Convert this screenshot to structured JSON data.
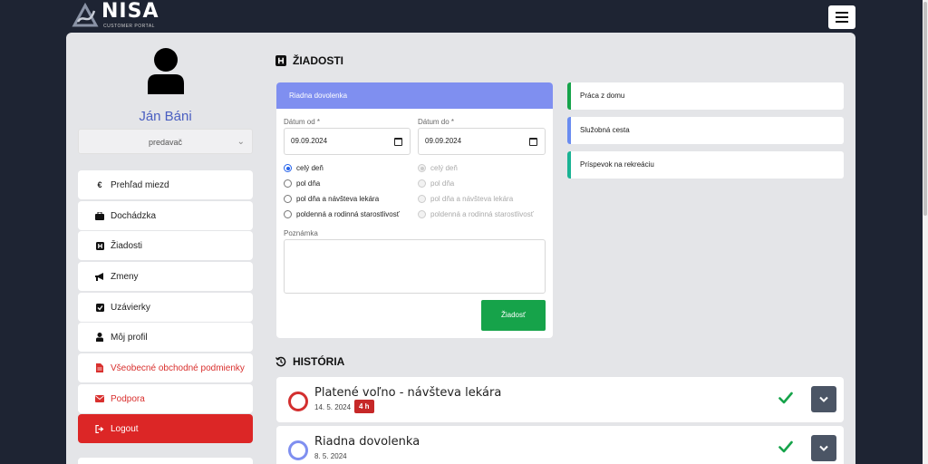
{
  "app": {
    "logo_text": "NISA",
    "logo_sub": "CUSTOMER PORTAL"
  },
  "user": {
    "name": "Ján Báni",
    "role": "predavač"
  },
  "nav": [
    {
      "label": "Prehľad miezd",
      "icon": "euro-icon"
    },
    {
      "label": "Dochádzka",
      "icon": "briefcase-icon"
    },
    {
      "label": "Žiadosti",
      "icon": "h-square-icon"
    },
    {
      "label": "Zmeny",
      "icon": "megaphone-icon"
    },
    {
      "label": "Uzávierky",
      "icon": "check-square-icon"
    },
    {
      "label": "Môj profil",
      "icon": "user-icon"
    },
    {
      "label": "Všeobecné obchodné podmienky",
      "icon": "document-icon"
    },
    {
      "label": "Podpora",
      "icon": "envelope-icon"
    },
    {
      "label": "Logout",
      "icon": "sign-out-icon"
    }
  ],
  "requests": {
    "title": "ŽIADOSTI",
    "form": {
      "header": "Riadna dovolenka",
      "date_from_label": "Dátum od *",
      "date_from_value": "09.09.2024",
      "date_to_label": "Dátum do *",
      "date_to_value": "09.09.2024",
      "options_from": [
        "celý deň",
        "pol dňa",
        "pol dňa a návšteva lekára",
        "poldenná a rodinná starostlivosť"
      ],
      "options_to": [
        "celý deň",
        "pol dňa",
        "pol dňa a návšteva lekára",
        "poldenná a rodinná starostlivosť"
      ],
      "selected_option": "celý deň",
      "note_label": "Poznámka",
      "note_value": "",
      "submit_label": "Žiadosť"
    },
    "types": [
      {
        "label": "Práca z domu",
        "color": "#16a34a"
      },
      {
        "label": "Služobná cesta",
        "color": "#6a8cf0"
      },
      {
        "label": "Príspevok na rekreáciu",
        "color": "#1ab394"
      }
    ]
  },
  "history": {
    "title": "HISTÓRIA",
    "items": [
      {
        "title": "Platené voľno - návšteva lekára",
        "date": "14. 5. 2024",
        "badge": "4 h",
        "color": "#d32f2f",
        "status": "approved"
      },
      {
        "title": "Riadna dovolenka",
        "date": "8. 5. 2024",
        "badge": "",
        "color": "#7f8ff0",
        "status": "approved"
      }
    ]
  },
  "colors": {
    "accent": "#7f8ff0",
    "success": "#16a34a",
    "danger": "#dc2626",
    "dark": "#1e2433"
  }
}
